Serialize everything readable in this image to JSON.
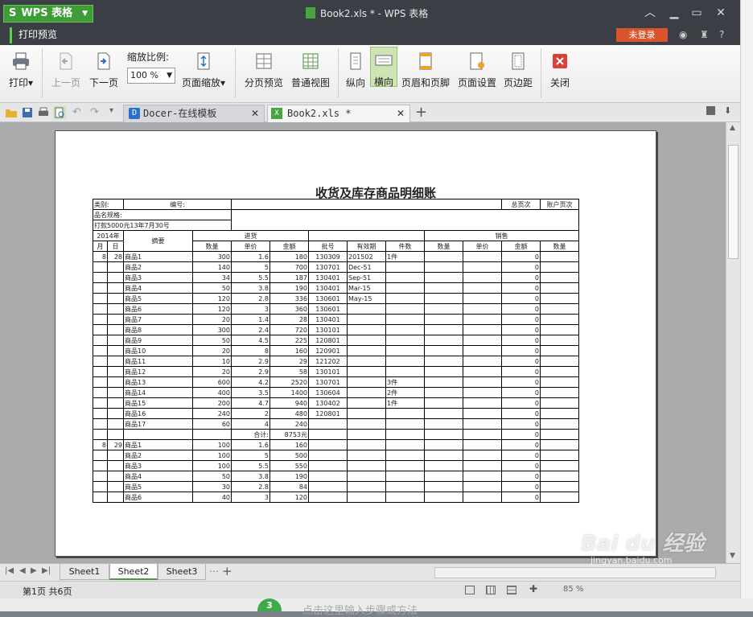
{
  "app": {
    "name": "WPS 表格",
    "doc_title": "Book2.xls * - WPS 表格",
    "mode_tab": "打印预览",
    "login": "未登录"
  },
  "ribbon": {
    "print": "打印",
    "prev_page": "上一页",
    "next_page": "下一页",
    "zoom_label": "缩放比例:",
    "zoom_value": "100 %",
    "page_zoom": "页面缩放",
    "page_break": "分页预览",
    "normal_view": "普通视图",
    "portrait": "纵向",
    "landscape": "横向",
    "header_footer": "页眉和页脚",
    "page_setup": "页面设置",
    "margins": "页边距",
    "close": "关闭"
  },
  "doc_tabs": [
    {
      "label": "Docer-在线模板"
    },
    {
      "label": "Book2.xls *"
    }
  ],
  "sheet": {
    "title": "收货及库存商品明细账",
    "hdr": {
      "category": "类别:",
      "number": "编号:",
      "total_page": "总页次",
      "account_page": "账户页次",
      "spec": "品名规格:",
      "note": "打款5000元13年7月30号",
      "year": "2014年",
      "month": "月",
      "day": "日",
      "summary": "摘要",
      "inbound": "进货",
      "sales": "销售",
      "qty": "数量",
      "price": "单价",
      "amount": "金额",
      "batch": "批号",
      "expiry": "有效期",
      "pieces": "件数"
    },
    "rows": [
      [
        "8",
        "28",
        "商品1",
        "300",
        "1.6",
        "180",
        "130309",
        "201502",
        "1件",
        "",
        "",
        "0",
        ""
      ],
      [
        "",
        "",
        "商品2",
        "140",
        "5",
        "700",
        "130701",
        "Dec-51",
        "",
        "",
        "",
        "0",
        ""
      ],
      [
        "",
        "",
        "商品3",
        "34",
        "5.5",
        "187",
        "130401",
        "Sep-51",
        "",
        "",
        "",
        "0",
        ""
      ],
      [
        "",
        "",
        "商品4",
        "50",
        "3.8",
        "190",
        "130401",
        "Mar-15",
        "",
        "",
        "",
        "0",
        ""
      ],
      [
        "",
        "",
        "商品5",
        "120",
        "2.8",
        "336",
        "130601",
        "May-15",
        "",
        "",
        "",
        "0",
        ""
      ],
      [
        "",
        "",
        "商品6",
        "120",
        "3",
        "360",
        "130601",
        "",
        "",
        "",
        "",
        "0",
        ""
      ],
      [
        "",
        "",
        "商品7",
        "20",
        "1.4",
        "28",
        "130401",
        "",
        "",
        "",
        "",
        "0",
        ""
      ],
      [
        "",
        "",
        "商品8",
        "300",
        "2.4",
        "720",
        "130101",
        "",
        "",
        "",
        "",
        "0",
        ""
      ],
      [
        "",
        "",
        "商品9",
        "50",
        "4.5",
        "225",
        "120801",
        "",
        "",
        "",
        "",
        "0",
        ""
      ],
      [
        "",
        "",
        "商品10",
        "20",
        "8",
        "160",
        "120901",
        "",
        "",
        "",
        "",
        "0",
        ""
      ],
      [
        "",
        "",
        "商品11",
        "10",
        "2.9",
        "29",
        "121202",
        "",
        "",
        "",
        "",
        "0",
        ""
      ],
      [
        "",
        "",
        "商品12",
        "20",
        "2.9",
        "58",
        "130101",
        "",
        "",
        "",
        "",
        "0",
        ""
      ],
      [
        "",
        "",
        "商品13",
        "600",
        "4.2",
        "2520",
        "130701",
        "",
        "3件",
        "",
        "",
        "0",
        ""
      ],
      [
        "",
        "",
        "商品14",
        "400",
        "3.5",
        "1400",
        "130604",
        "",
        "2件",
        "",
        "",
        "0",
        ""
      ],
      [
        "",
        "",
        "商品15",
        "200",
        "4.7",
        "940",
        "130402",
        "",
        "1件",
        "",
        "",
        "0",
        ""
      ],
      [
        "",
        "",
        "商品16",
        "240",
        "2",
        "480",
        "120801",
        "",
        "",
        "",
        "",
        "0",
        ""
      ],
      [
        "",
        "",
        "商品17",
        "60",
        "4",
        "240",
        "",
        "",
        "",
        "",
        "",
        "0",
        ""
      ],
      [
        "",
        "",
        "",
        "",
        "合计:",
        "8753元",
        "",
        "",
        "",
        "",
        "",
        "0",
        ""
      ],
      [
        "8",
        "29",
        "商品1",
        "100",
        "1.6",
        "160",
        "",
        "",
        "",
        "",
        "",
        "0",
        ""
      ],
      [
        "",
        "",
        "商品2",
        "100",
        "5",
        "500",
        "",
        "",
        "",
        "",
        "",
        "0",
        ""
      ],
      [
        "",
        "",
        "商品3",
        "100",
        "5.5",
        "550",
        "",
        "",
        "",
        "",
        "",
        "0",
        ""
      ],
      [
        "",
        "",
        "商品4",
        "50",
        "3.8",
        "190",
        "",
        "",
        "",
        "",
        "",
        "0",
        ""
      ],
      [
        "",
        "",
        "商品5",
        "30",
        "2.8",
        "84",
        "",
        "",
        "",
        "",
        "",
        "0",
        ""
      ],
      [
        "",
        "",
        "商品6",
        "40",
        "3",
        "120",
        "",
        "",
        "",
        "",
        "",
        "0",
        ""
      ]
    ]
  },
  "sheet_tabs": [
    {
      "label": "Sheet1"
    },
    {
      "label": "Sheet2"
    },
    {
      "label": "Sheet3"
    }
  ],
  "status": {
    "page_info": "第1页 共6页",
    "zoom": "85 %"
  },
  "overlay": {
    "step_num": "3",
    "step_text": "点击这里输入步骤或方法",
    "watermark": "Bai du 经验",
    "watermark_url": "jingyan.baidu.com"
  }
}
